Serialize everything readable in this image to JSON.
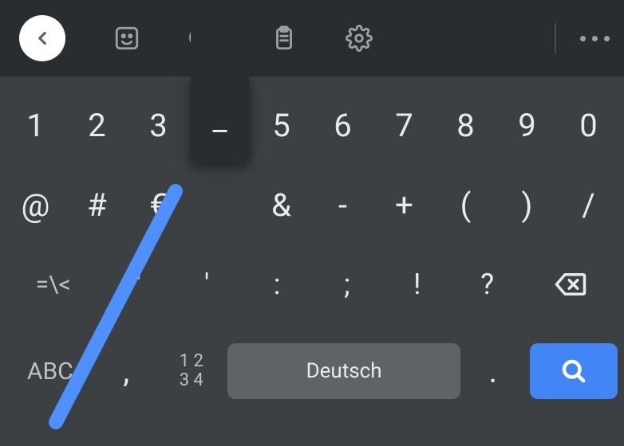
{
  "toolbar": {
    "gif_label": "GIF"
  },
  "rows": {
    "r1": [
      "1",
      "2",
      "3",
      "_",
      "5",
      "6",
      "7",
      "8",
      "9",
      "0"
    ],
    "r2": [
      "@",
      "#",
      "€",
      "",
      "&",
      "-",
      "+",
      "(",
      ")",
      "/"
    ],
    "r3_first": "=\\<",
    "r3": [
      "\"",
      "'",
      ":",
      ";",
      "!",
      "?"
    ],
    "r4": {
      "mode": "ABC",
      "comma": ",",
      "numpad_top": "1 2",
      "numpad_bottom": "3 4",
      "space": "Deutsch",
      "period": "."
    }
  },
  "popup_key": "_",
  "colors": {
    "accent": "#4285f4"
  }
}
